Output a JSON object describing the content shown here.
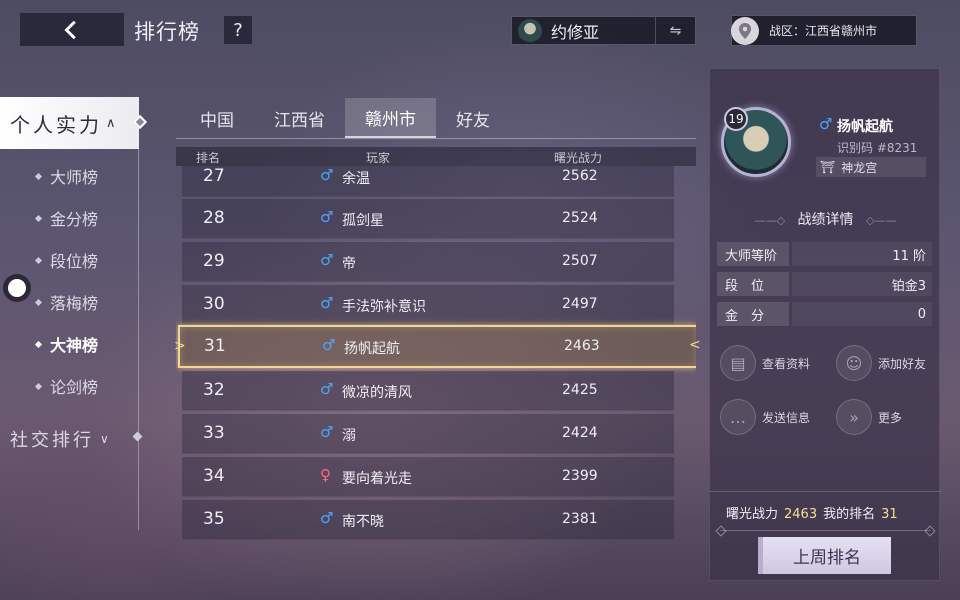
{
  "header": {
    "title": "排行榜",
    "help_label": "?",
    "character_name": "约修亚",
    "switch_label": "⇋",
    "region_label": "战区：江西省赣州市"
  },
  "nav": {
    "main_label": "个人实力",
    "items": [
      {
        "label": "大师榜"
      },
      {
        "label": "金分榜"
      },
      {
        "label": "段位榜"
      },
      {
        "label": "落梅榜"
      },
      {
        "label": "大神榜"
      },
      {
        "label": "论剑榜"
      }
    ],
    "active_index": 4,
    "social_label": "社交排行"
  },
  "tabs": [
    {
      "label": "中国"
    },
    {
      "label": "江西省"
    },
    {
      "label": "赣州市"
    },
    {
      "label": "好友"
    }
  ],
  "active_tab_index": 2,
  "table": {
    "headers": {
      "rank": "排名",
      "player": "玩家",
      "power": "曙光战力"
    },
    "rows": [
      {
        "rank": "27",
        "sex": "♂",
        "name": "余温",
        "power": "2562"
      },
      {
        "rank": "28",
        "sex": "♂",
        "name": "孤剑星",
        "power": "2524"
      },
      {
        "rank": "29",
        "sex": "♂",
        "name": "帝",
        "power": "2507"
      },
      {
        "rank": "30",
        "sex": "♂",
        "name": "手法弥补意识",
        "power": "2497"
      },
      {
        "rank": "31",
        "sex": "♂",
        "name": "扬帆起航",
        "power": "2463"
      },
      {
        "rank": "32",
        "sex": "♂",
        "name": "微凉的清风",
        "power": "2425"
      },
      {
        "rank": "33",
        "sex": "♂",
        "name": "溺",
        "power": "2424"
      },
      {
        "rank": "34",
        "sex": "♀",
        "name": "要向着光走",
        "power": "2399"
      },
      {
        "rank": "35",
        "sex": "♂",
        "name": "南不晓",
        "power": "2381"
      }
    ],
    "highlight_index": 4
  },
  "profile": {
    "level": "19",
    "sex": "♂",
    "name": "扬帆起航",
    "id_code": "识别码 #8231",
    "guild": "神龙宫",
    "stats_title": "战绩详情",
    "stats": [
      {
        "key": "大师等阶",
        "value": "11 阶"
      },
      {
        "key": "段　位",
        "value": "铂金3"
      },
      {
        "key": "金　分",
        "value": "0"
      }
    ],
    "actions": {
      "view_profile": "查看资料",
      "add_friend": "添加好友",
      "send_message": "发送信息",
      "more": "更多"
    },
    "footer": {
      "power_label": "曙光战力",
      "power_value": "2463",
      "rank_label": "我的排名",
      "rank_value": "31"
    },
    "last_week_button": "上周排名"
  },
  "colors": {
    "male": "#49a6ff",
    "female": "#ff6b7c",
    "highlight_border": "#f4d58c",
    "footer_number": "#f4e08c"
  }
}
